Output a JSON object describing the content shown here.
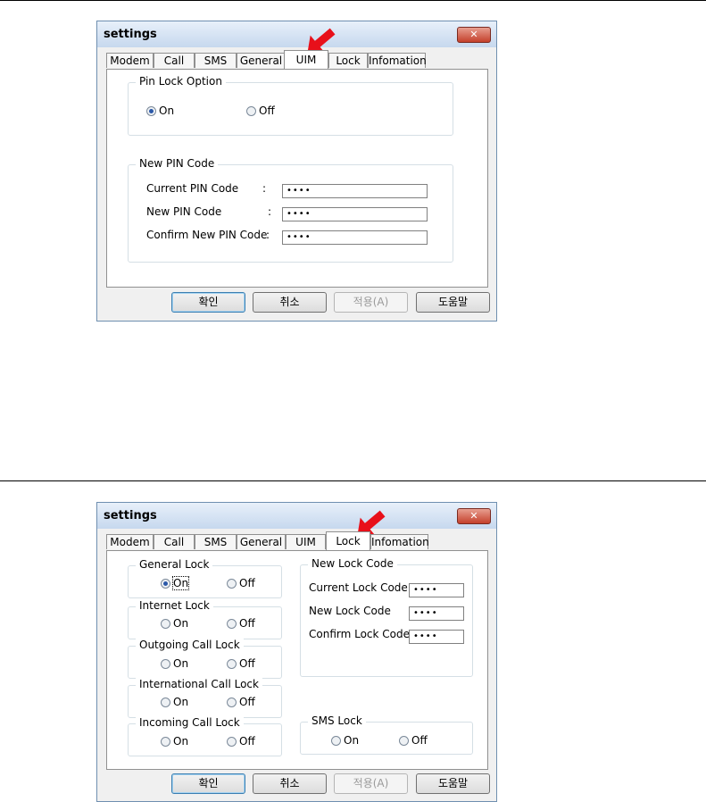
{
  "dialog1": {
    "title": "settings",
    "close": "✕",
    "tabs": [
      "Modem",
      "Call",
      "SMS",
      "General",
      "UIM",
      "Lock",
      "Infomation"
    ],
    "active_tab": "UIM",
    "pin_group": {
      "title": "Pin Lock Option",
      "on": "On",
      "off": "Off",
      "selected": "On"
    },
    "new_pin_group": {
      "title": "New PIN Code",
      "current_label": "Current PIN Code",
      "new_label": "New PIN Code",
      "confirm_label": "Confirm New PIN Code",
      "colon": ":",
      "current_value": "••••",
      "new_value": "••••",
      "confirm_value": "••••"
    },
    "buttons": {
      "ok": "확인",
      "cancel": "취소",
      "apply": "적용(A)",
      "help": "도움말"
    }
  },
  "dialog2": {
    "title": "settings",
    "close": "✕",
    "tabs": [
      "Modem",
      "Call",
      "SMS",
      "General",
      "UIM",
      "Lock",
      "Infomation"
    ],
    "active_tab": "Lock",
    "general_lock": {
      "title": "General Lock",
      "on": "On",
      "off": "Off"
    },
    "internet_lock": {
      "title": "Internet Lock",
      "on": "On",
      "off": "Off"
    },
    "outgoing_call_lock": {
      "title": "Outgoing Call Lock",
      "on": "On",
      "off": "Off"
    },
    "international_call_lock": {
      "title": "International Call Lock",
      "on": "On",
      "off": "Off"
    },
    "incoming_call_lock": {
      "title": "Incoming Call Lock",
      "on": "On",
      "off": "Off"
    },
    "new_lock_code": {
      "title": "New Lock Code",
      "current_label": "Current Lock Code",
      "new_label": "New Lock Code",
      "confirm_label": "Confirm Lock Code",
      "current_value": "••••",
      "new_value": "••••",
      "confirm_value": "••••"
    },
    "sms_lock": {
      "title": "SMS Lock",
      "on": "On",
      "off": "Off"
    },
    "buttons": {
      "ok": "확인",
      "cancel": "취소",
      "apply": "적용(A)",
      "help": "도움말"
    }
  },
  "colors": {
    "arrow": "#e8101a",
    "title_bar": "#c6d8ee",
    "close_button": "#c4402b"
  }
}
